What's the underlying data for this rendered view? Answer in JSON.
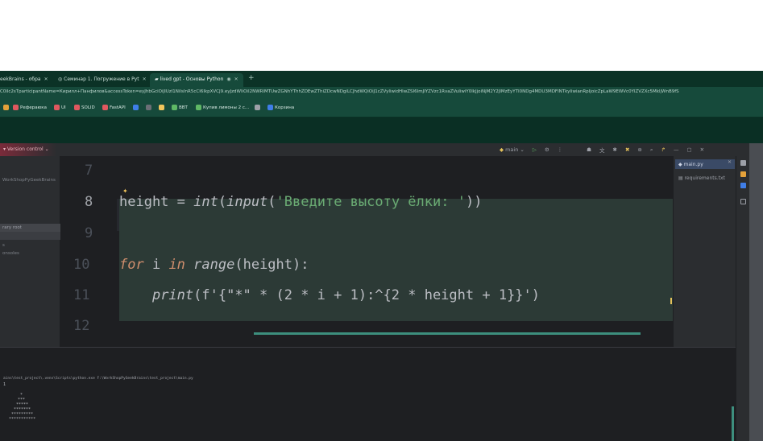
{
  "browser": {
    "tabs": [
      {
        "label": "eekBrains - обра",
        "active": false
      },
      {
        "label": "Семинар 1. Погружение в Pyt",
        "active": false
      },
      {
        "label": "lived gpt - Основы Python",
        "active": true
      }
    ],
    "new_tab": "+",
    "url": "C0ilc2sTparticipantName=Кирилл+Панфилов&accessToken=eyJhbGciOiJIUzI1NiIsInR5cCI6IkpXVCJ9.eyJzdWIiOiI2NWRlMTUwZGNhYThhZDEwZThiZDcwNDgiLCJhdWQiOiJ1cZVyIiwidHlwZSI6ImJIYZVzc1RvaZVuIiwiY0lkJjoiNjM2Y2JlMzEyYTI0NDg4MDU3MDFlNTkyIiwianRpIjoicZpLaW9EWVc0YlZVZXc5MkljWnB9fS",
    "bookmarks": [
      {
        "label": "",
        "color": "#e4a13a"
      },
      {
        "label": "Рефераюка",
        "color": "#e0585f"
      },
      {
        "label": "UI",
        "color": "#e0585f"
      },
      {
        "label": "SOLID",
        "color": "#e0585f"
      },
      {
        "label": "FastAPI",
        "color": "#e0585f"
      },
      {
        "label": "",
        "color": "#3f7ee8"
      },
      {
        "label": "",
        "color": "#6b6f76"
      },
      {
        "label": "",
        "color": "#f2c55c"
      },
      {
        "label": "BBT",
        "color": "#5fb865"
      },
      {
        "label": "Купив лимоны 2 с...",
        "color": "#5fb865"
      },
      {
        "label": "",
        "color": "#9da0a8"
      },
      {
        "label": "Корзина",
        "color": "#3f7ee8"
      }
    ]
  },
  "ide": {
    "version_control": "Version control",
    "branch": "main",
    "project_panel": {
      "root": "WorkShopPyGeekBrains",
      "items": [
        "rary root",
        "s",
        "onsoles"
      ]
    },
    "editor": {
      "line_numbers": [
        "7",
        "8",
        "9",
        "10",
        "11",
        "12"
      ],
      "line8": {
        "var": "height",
        "op": " = ",
        "int": "int",
        "open": "(",
        "input": "input",
        "open2": "(",
        "str": "'Введите высоту ёлки: '",
        "close": "))"
      },
      "line10": {
        "for": "for",
        "i": " i ",
        "in": "in",
        "range": "range",
        "args": "(height):"
      },
      "line11": {
        "indent": "    ",
        "print": "print",
        "args": "(f'{\"*\" * (2 * i + 1):^{2 * height + 1}}')"
      }
    },
    "right_panel": {
      "active_file": "main.py",
      "file": "requirements.txt"
    },
    "console": {
      "command": "ains\\test_project\\.venv\\Scripts\\python.exe F:\\WorkShopPyGeekBrains\\test_project\\main.py",
      "tree": [
        "1",
        "*",
        "***",
        "*****",
        "*******",
        "*********",
        "***********"
      ]
    }
  },
  "colors": {
    "browser_bg": "#0f3d31",
    "ide_bg": "#1e1f22",
    "keyword": "#cf8e6d",
    "string": "#6aab73"
  }
}
